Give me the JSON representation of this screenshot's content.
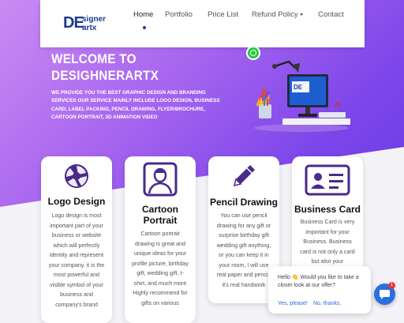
{
  "brand": {
    "logo_mark": "DE",
    "logo_top": "signer",
    "logo_bottom": "artx"
  },
  "nav": {
    "items": [
      "Home",
      "Portfolio",
      "Price List",
      "Refund Policy",
      "Contact"
    ],
    "active": "Home"
  },
  "hero": {
    "title_line1": "WELCOME TO",
    "title_line2": "DESIGHNERARTX",
    "description": "WE PROVIDE YOU THE BEST GRAPHIC DESIGN AND BRANDING SERVICES OUR SERVICE MAINLY INCLUDE LOGO DESIGN, BUSINESS CARD, LABEL PACKING, PENCIL DRAWING, FLYER/BROCHURE, CARTOON PORTRAIT, 3D ANIMATION VIDEO"
  },
  "cards": [
    {
      "title": "Logo Design",
      "icon": "aperture-icon",
      "text": "Logo design is most important part of your business or website which will perfectly identity and represent your company. it is the most powerful and visible symbol of your business and company's brand"
    },
    {
      "title_line1": "Cartoon",
      "title_line2": "Portrait",
      "icon": "portrait-icon",
      "text": "Cartoon portrait drawing is great and unique ideas for your profile picture, birthday gift, wedding gift, t-shirt, and much more Highly recommend for gifts on various"
    },
    {
      "title": "Pencil Drawing",
      "icon": "pencil-icon",
      "text": "You can use pencil drawing for any gift or surprise birthday gift wedding gift anything, or you can keep it in your room, I will use real paper and pencil, it's real handwork"
    },
    {
      "title": "Business Card",
      "icon": "id-card-icon",
      "text": "Business Card is very important for your Business. Business card is not only a card but also your"
    }
  ],
  "chat": {
    "message": "Hello 👋 Would you like to take a closer look at our offer?",
    "yes": "Yes, please!",
    "no": "No, thanks.",
    "badge": "1"
  },
  "colors": {
    "hero_start": "#c98cf2",
    "hero_end": "#6a3ae6",
    "icon_purple": "#4a2a8c",
    "chat_blue": "#2b6ee0"
  }
}
